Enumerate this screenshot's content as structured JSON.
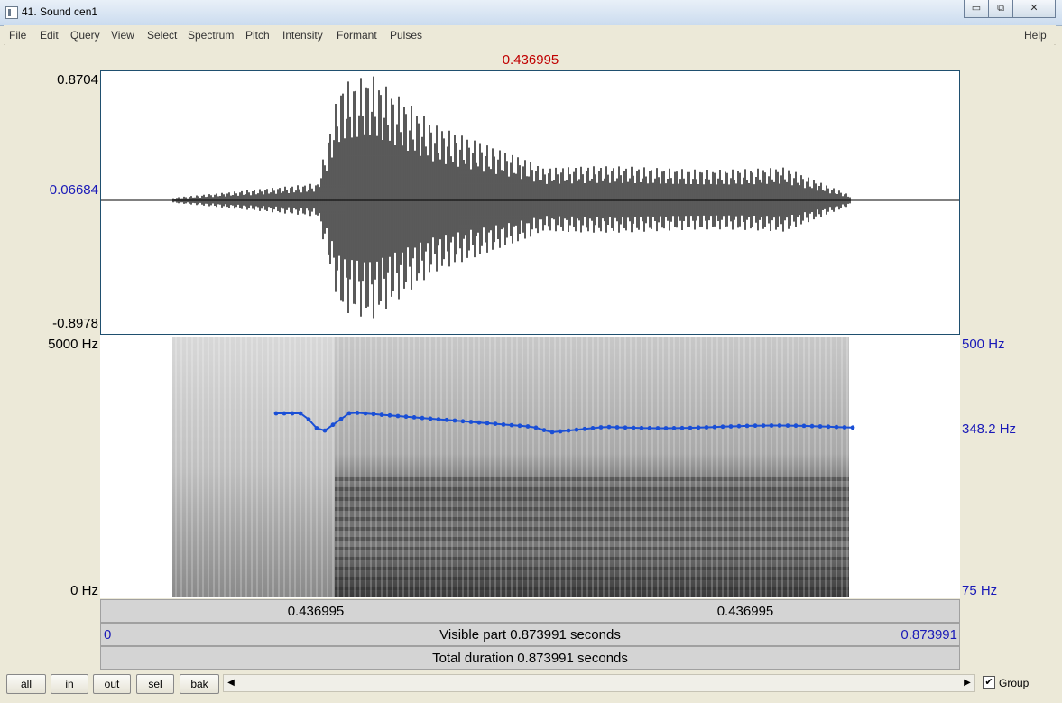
{
  "window": {
    "title": "41. Sound cen1"
  },
  "window_controls": {
    "minimize": "▭",
    "maximize": "⧉",
    "close": "✕"
  },
  "menu": [
    "File",
    "Edit",
    "Query",
    "View",
    "Select",
    "Spectrum",
    "Pitch",
    "Intensity",
    "Formant",
    "Pulses"
  ],
  "help": "Help",
  "cursor_time": "0.436995",
  "waveform": {
    "ymax": "0.8704",
    "yzero": "0.06684",
    "ymin": "-0.8978"
  },
  "spectrogram": {
    "fmax": "5000 Hz",
    "fmin": "0 Hz"
  },
  "pitch": {
    "top": "500 Hz",
    "value": "348.2 Hz",
    "bottom": "75 Hz",
    "color": "#1a4fd6"
  },
  "time_bars": {
    "left_segment": "0.436995",
    "right_segment": "0.436995",
    "start": "0",
    "end": "0.873991",
    "visible": "Visible part 0.873991 seconds",
    "total": "Total duration 0.873991 seconds"
  },
  "buttons": {
    "all": "all",
    "in": "in",
    "out": "out",
    "sel": "sel",
    "bak": "bak"
  },
  "scroll_arrows": {
    "left": "◀",
    "right": "▶"
  },
  "group": {
    "label": "Group",
    "checked": true,
    "mark": "✔"
  }
}
